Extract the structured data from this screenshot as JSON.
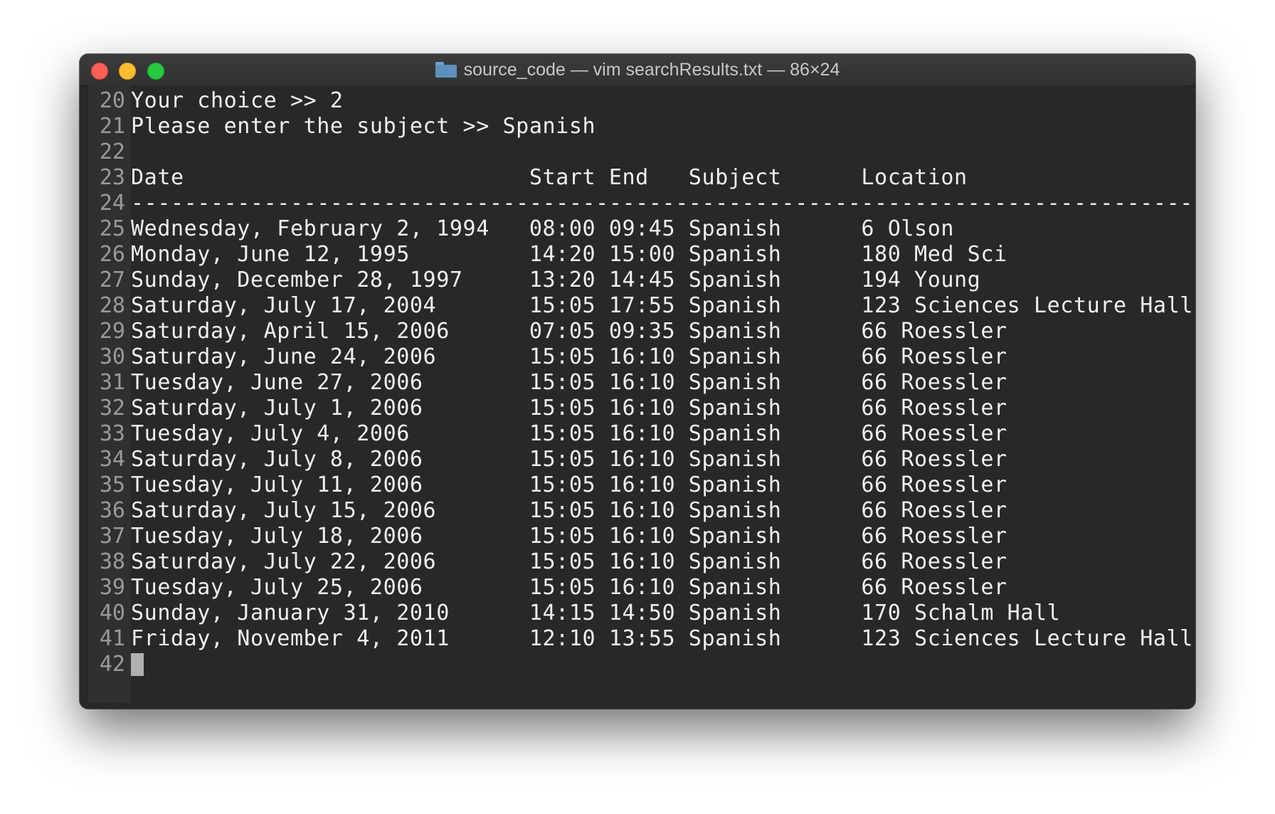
{
  "window": {
    "title": "source_code — vim searchResults.txt — 86×24"
  },
  "editor": {
    "lines": [
      {
        "num": "20",
        "text": "Your choice >> 2"
      },
      {
        "num": "21",
        "text": "Please enter the subject >> Spanish"
      },
      {
        "num": "22",
        "text": ""
      },
      {
        "num": "23",
        "text": "Date                          Start End   Subject      Location"
      },
      {
        "num": "24",
        "text": "--------------------------------------------------------------------------------"
      },
      {
        "num": "25",
        "text": "Wednesday, February 2, 1994   08:00 09:45 Spanish      6 Olson"
      },
      {
        "num": "26",
        "text": "Monday, June 12, 1995         14:20 15:00 Spanish      180 Med Sci"
      },
      {
        "num": "27",
        "text": "Sunday, December 28, 1997     13:20 14:45 Spanish      194 Young"
      },
      {
        "num": "28",
        "text": "Saturday, July 17, 2004       15:05 17:55 Spanish      123 Sciences Lecture Hall"
      },
      {
        "num": "29",
        "text": "Saturday, April 15, 2006      07:05 09:35 Spanish      66 Roessler"
      },
      {
        "num": "30",
        "text": "Saturday, June 24, 2006       15:05 16:10 Spanish      66 Roessler"
      },
      {
        "num": "31",
        "text": "Tuesday, June 27, 2006        15:05 16:10 Spanish      66 Roessler"
      },
      {
        "num": "32",
        "text": "Saturday, July 1, 2006        15:05 16:10 Spanish      66 Roessler"
      },
      {
        "num": "33",
        "text": "Tuesday, July 4, 2006         15:05 16:10 Spanish      66 Roessler"
      },
      {
        "num": "34",
        "text": "Saturday, July 8, 2006        15:05 16:10 Spanish      66 Roessler"
      },
      {
        "num": "35",
        "text": "Tuesday, July 11, 2006        15:05 16:10 Spanish      66 Roessler"
      },
      {
        "num": "36",
        "text": "Saturday, July 15, 2006       15:05 16:10 Spanish      66 Roessler"
      },
      {
        "num": "37",
        "text": "Tuesday, July 18, 2006        15:05 16:10 Spanish      66 Roessler"
      },
      {
        "num": "38",
        "text": "Saturday, July 22, 2006       15:05 16:10 Spanish      66 Roessler"
      },
      {
        "num": "39",
        "text": "Tuesday, July 25, 2006        15:05 16:10 Spanish      66 Roessler"
      },
      {
        "num": "40",
        "text": "Sunday, January 31, 2010      14:15 14:50 Spanish      170 Schalm Hall"
      },
      {
        "num": "41",
        "text": "Friday, November 4, 2011      12:10 13:55 Spanish      123 Sciences Lecture Hall"
      },
      {
        "num": "42",
        "text": ""
      }
    ]
  },
  "colors": {
    "close": "#ff5f57",
    "minimize": "#febc2e",
    "zoom": "#28c840",
    "background": "#282828",
    "text": "#f0f0f0",
    "line_number": "#9a9a9a"
  },
  "icons": {
    "title_icon": "folder-icon"
  }
}
